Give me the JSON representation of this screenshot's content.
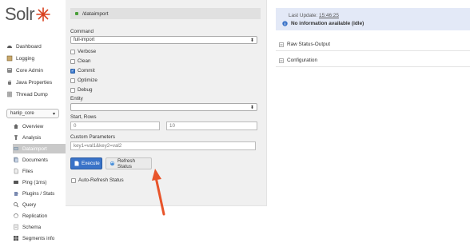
{
  "logo": {
    "text": "Solr"
  },
  "colors": {
    "accent": "#3a73c8",
    "status_bg": "#e3e9f7",
    "logo_orange": "#d9411e"
  },
  "sidebar": {
    "items": [
      {
        "label": "Dashboard",
        "icon": "dashboard-icon"
      },
      {
        "label": "Logging",
        "icon": "logging-icon"
      },
      {
        "label": "Core Admin",
        "icon": "core-admin-icon"
      },
      {
        "label": "Java Properties",
        "icon": "java-icon"
      },
      {
        "label": "Thread Dump",
        "icon": "thread-icon"
      }
    ],
    "core_selector": {
      "value": "hanlp_core"
    },
    "core_items": [
      {
        "label": "Overview",
        "icon": "overview-icon"
      },
      {
        "label": "Analysis",
        "icon": "analysis-icon"
      },
      {
        "label": "Dataimport",
        "icon": "dataimport-icon"
      },
      {
        "label": "Documents",
        "icon": "documents-icon"
      },
      {
        "label": "Files",
        "icon": "files-icon"
      },
      {
        "label": "Ping (1ms)",
        "icon": "ping-icon"
      },
      {
        "label": "Plugins / Stats",
        "icon": "plugins-icon"
      },
      {
        "label": "Query",
        "icon": "query-icon"
      },
      {
        "label": "Replication",
        "icon": "replication-icon"
      },
      {
        "label": "Schema",
        "icon": "schema-icon"
      },
      {
        "label": "Segments info",
        "icon": "segments-icon"
      }
    ]
  },
  "main": {
    "header": "/dataimport",
    "command_label": "Command",
    "command_value": "full-import",
    "options": [
      {
        "label": "Verbose",
        "checked": false
      },
      {
        "label": "Clean",
        "checked": false
      },
      {
        "label": "Commit",
        "checked": true
      },
      {
        "label": "Optimize",
        "checked": false
      },
      {
        "label": "Debug",
        "checked": false
      }
    ],
    "entity_label": "Entity",
    "entity_value": "",
    "start_rows_label": "Start, Rows",
    "start_value": "0",
    "rows_value": "10",
    "custom_params_label": "Custom Parameters",
    "custom_params_value": "key1=val1&key2=val2",
    "execute_label": "Execute",
    "refresh_label": "Refresh Status",
    "auto_refresh_label": "Auto-Refresh Status"
  },
  "status": {
    "last_update_label": "Last Update:",
    "last_update_time": "15:46:25",
    "message": "No information available (idle)"
  },
  "sections": [
    {
      "label": "Raw Status-Output"
    },
    {
      "label": "Configuration"
    }
  ]
}
